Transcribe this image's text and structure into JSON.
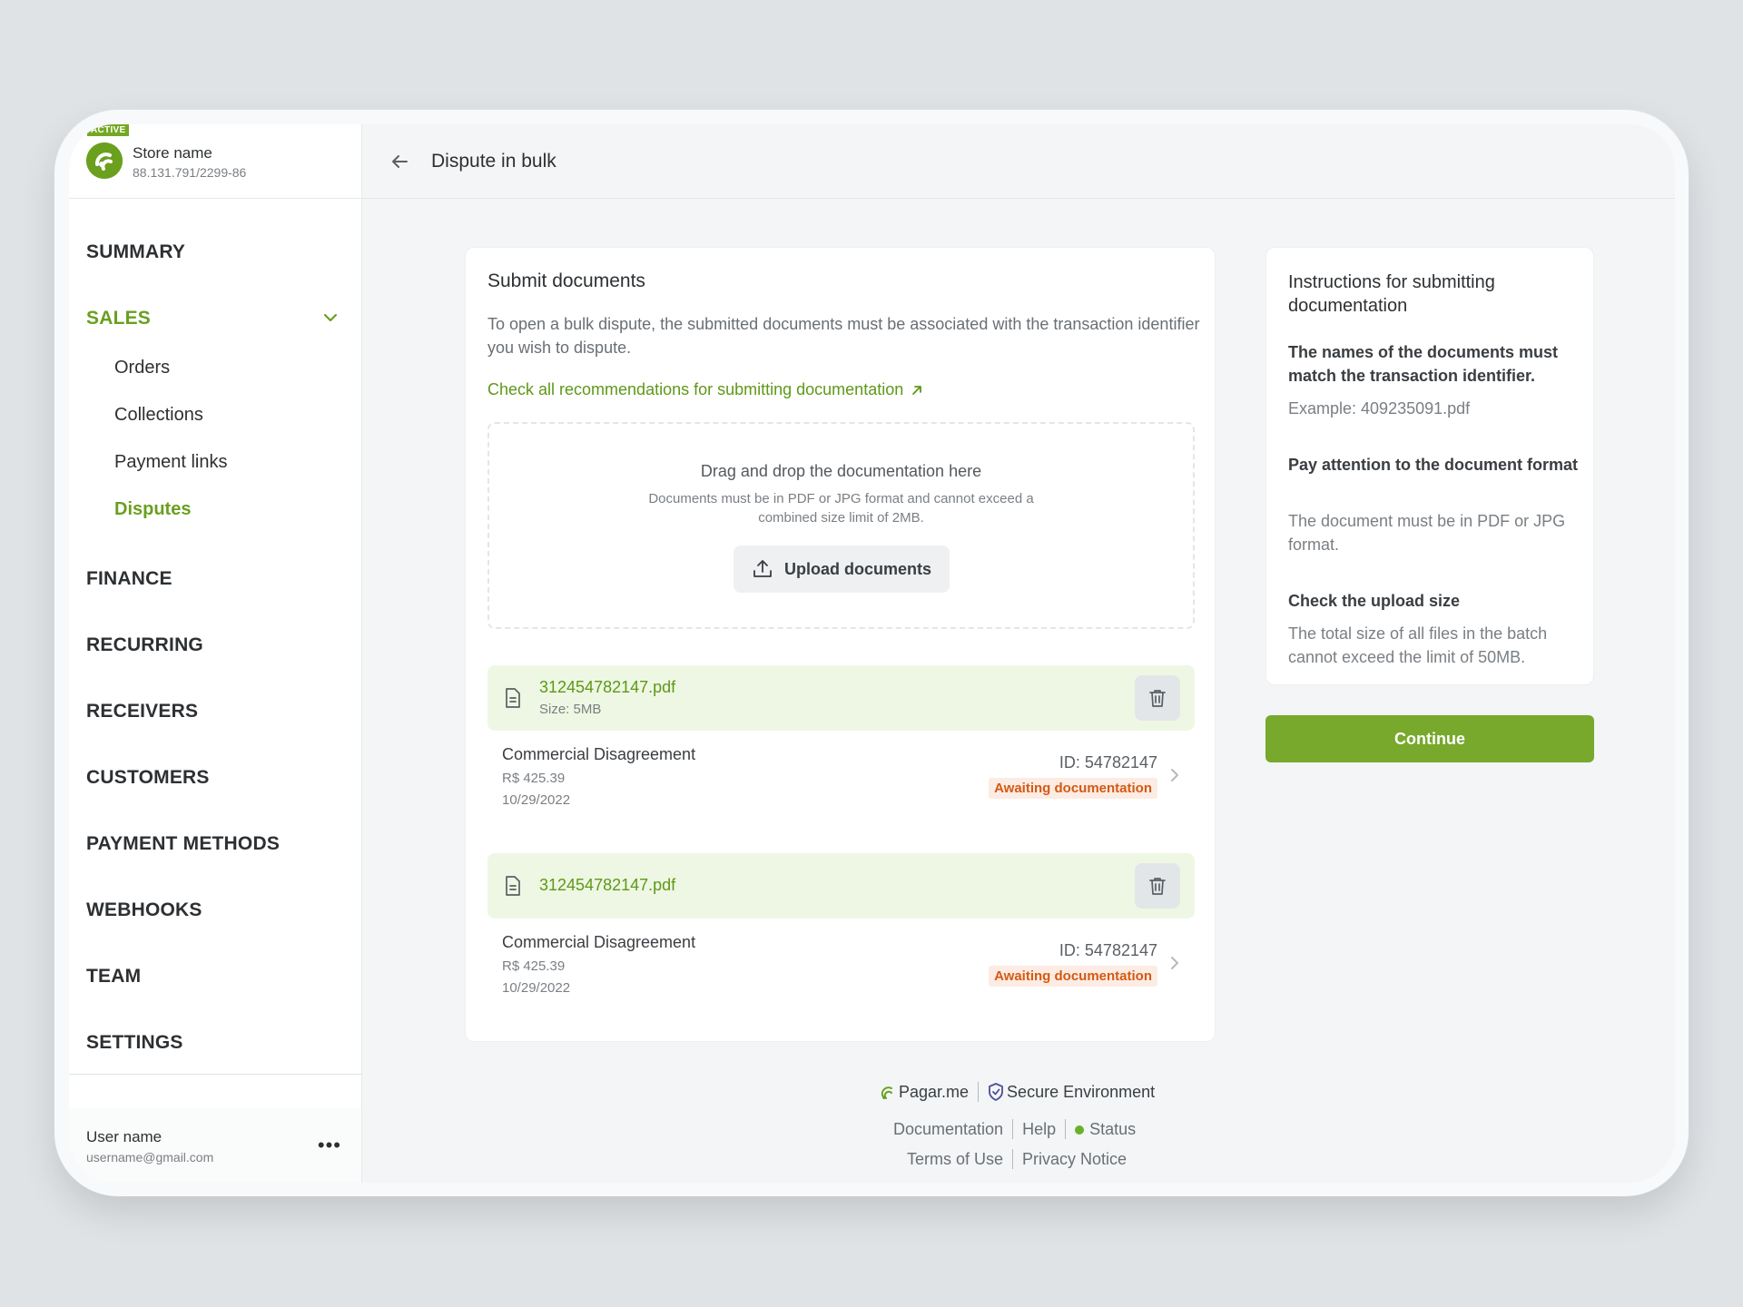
{
  "store": {
    "badge": "ACTIVE",
    "name": "Store name",
    "id": "88.131.791/2299-86"
  },
  "nav": {
    "summary": "SUMMARY",
    "sales": "SALES",
    "sales_sub": [
      "Orders",
      "Collections",
      "Payment links",
      "Disputes"
    ],
    "finance": "FINANCE",
    "recurring": "RECURRING",
    "receivers": "RECEIVERS",
    "customers": "CUSTOMERS",
    "payment_methods": "PAYMENT METHODS",
    "webhooks": "WEBHOOKS",
    "team": "TEAM",
    "settings": "SETTINGS"
  },
  "user": {
    "name": "User name",
    "email": "username@gmail.com",
    "menu": "•••"
  },
  "header": {
    "title": "Dispute in bulk"
  },
  "submit": {
    "title": "Submit documents",
    "description": "To open a bulk dispute, the submitted documents must be associated with the transaction identifier you wish to dispute.",
    "link": "Check all recommendations for submitting documentation",
    "dropzone_title": "Drag and drop the documentation here",
    "dropzone_note": "Documents must be in PDF or JPG format and cannot exceed a combined size limit of 2MB.",
    "upload_label": "Upload documents"
  },
  "files": [
    {
      "name": "312454782147.pdf",
      "size": "Size: 5MB",
      "reason": "Commercial Disagreement",
      "amount": "R$ 425.39",
      "date": "10/29/2022",
      "id": "ID: 54782147",
      "status": "Awaiting documentation"
    },
    {
      "name": "312454782147.pdf",
      "size": "",
      "reason": "Commercial Disagreement",
      "amount": "R$ 425.39",
      "date": "10/29/2022",
      "id": "ID: 54782147",
      "status": "Awaiting documentation"
    }
  ],
  "instructions": {
    "title": "Instructions for submitting documentation",
    "h1": "The names of the documents must match the transaction identifier.",
    "p1": "Example: 409235091.pdf",
    "h2": "Pay attention to the document format",
    "p2": "The document must be in PDF or JPG format.",
    "h3": "Check the upload size",
    "p3": "The total size of all files in the batch cannot exceed the limit of 50MB."
  },
  "continue_label": "Continue",
  "footer": {
    "brand": "Pagar.me",
    "secure": "Secure Environment",
    "documentation": "Documentation",
    "help": "Help",
    "status": "Status",
    "terms": "Terms of Use",
    "privacy": "Privacy Notice"
  },
  "colors": {
    "accent": "#6a9f1f",
    "button": "#78a82c",
    "badge_warning": "#d35a14"
  }
}
